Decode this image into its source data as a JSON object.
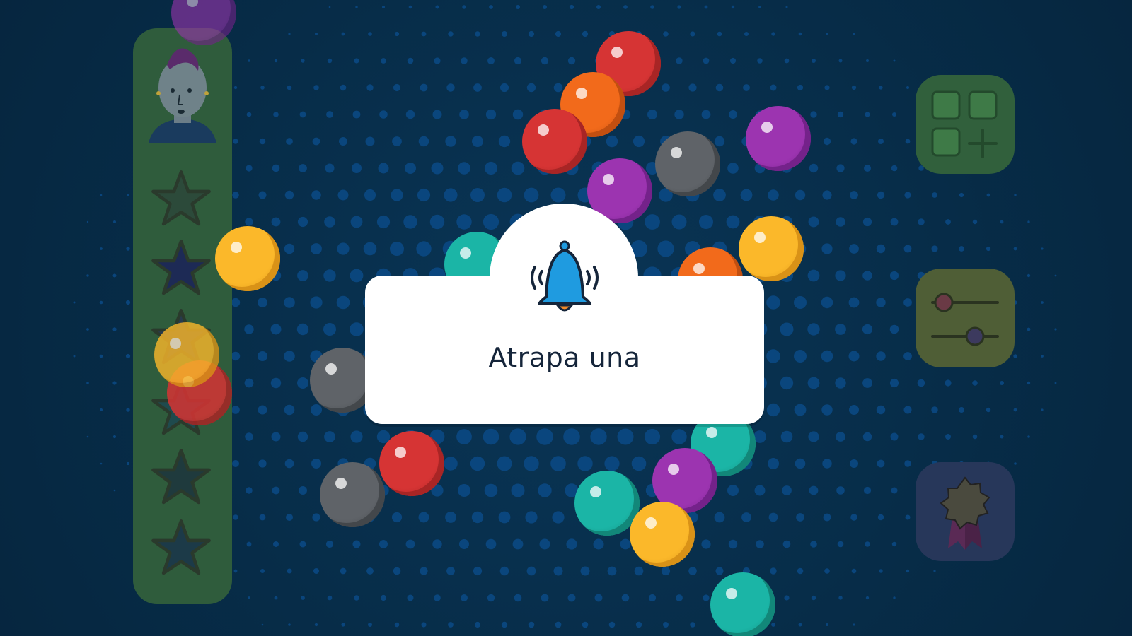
{
  "game": {
    "message": "Atrapa una",
    "bell_icon": "bell-ringing-icon",
    "stars_total": 6,
    "stars_earned": 0,
    "right_menu": [
      "add-grid-icon",
      "sliders-icon",
      "award-ribbon-icon"
    ]
  },
  "colors": {
    "background": "#062d47",
    "dot": "#0b4a86",
    "sidebar": "#2f5c3c",
    "card": "#ffffff",
    "bell": "#1f9be0",
    "text": "#15253a"
  },
  "ball_colors": [
    "red",
    "orange",
    "purple",
    "gray",
    "yellow",
    "teal"
  ]
}
